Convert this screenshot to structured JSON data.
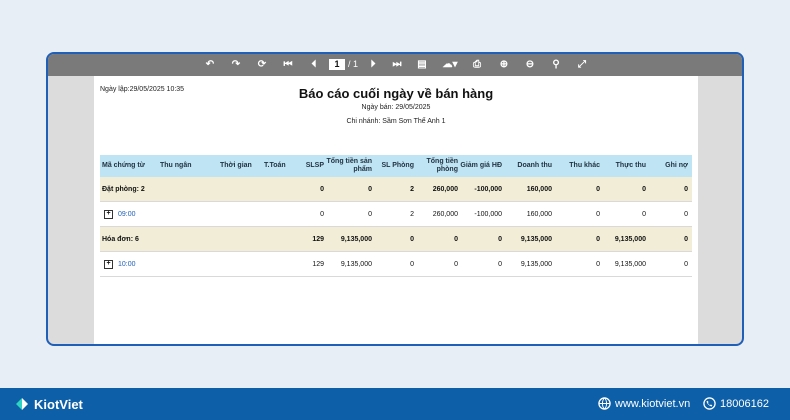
{
  "toolbar": {
    "icons": [
      "undo-icon",
      "redo-icon",
      "refresh-icon",
      "first-page-icon",
      "prev-page-icon",
      "next-page-icon",
      "last-page-icon",
      "document-icon",
      "export-icon",
      "print-icon",
      "zoom-in-icon",
      "zoom-out-icon",
      "search-icon",
      "fullscreen-icon"
    ],
    "page_current": "1",
    "page_total": "/ 1"
  },
  "report": {
    "created": "Ngày lập:29/05/2025 10:35",
    "title": "Báo cáo cuối ngày về bán hàng",
    "sale_date": "Ngày bán: 29/05/2025",
    "branch": "Chi nhánh: Sầm Sơn Thể Anh 1"
  },
  "table": {
    "headers": [
      "Mã chứng từ",
      "Thu ngân",
      "Thời gian",
      "T.Toán",
      "SLSP",
      "Tổng tiền sản phẩm",
      "SL Phòng",
      "Tổng tiền phòng",
      "Giảm giá HĐ",
      "Doanh thu",
      "Thu khác",
      "Thực thu",
      "Ghi nợ"
    ],
    "rows": [
      {
        "type": "group",
        "cells": [
          "Đặt phòng: 2",
          "",
          "",
          "",
          "0",
          "0",
          "2",
          "260,000",
          "-100,000",
          "160,000",
          "0",
          "0",
          "0"
        ]
      },
      {
        "type": "item",
        "cells": [
          "09:00",
          "",
          "",
          "",
          "0",
          "0",
          "2",
          "260,000",
          "-100,000",
          "160,000",
          "0",
          "0",
          "0"
        ]
      },
      {
        "type": "group",
        "cells": [
          "Hóa đơn: 6",
          "",
          "",
          "",
          "129",
          "9,135,000",
          "0",
          "0",
          "0",
          "9,135,000",
          "0",
          "9,135,000",
          "0"
        ]
      },
      {
        "type": "item",
        "cells": [
          "10:00",
          "",
          "",
          "",
          "129",
          "9,135,000",
          "0",
          "0",
          "0",
          "9,135,000",
          "0",
          "9,135,000",
          "0"
        ]
      }
    ]
  },
  "footer": {
    "brand": "KiotViet",
    "website": "www.kiotviet.vn",
    "phone": "18006162",
    "brand_color": "#0d5fa8"
  }
}
